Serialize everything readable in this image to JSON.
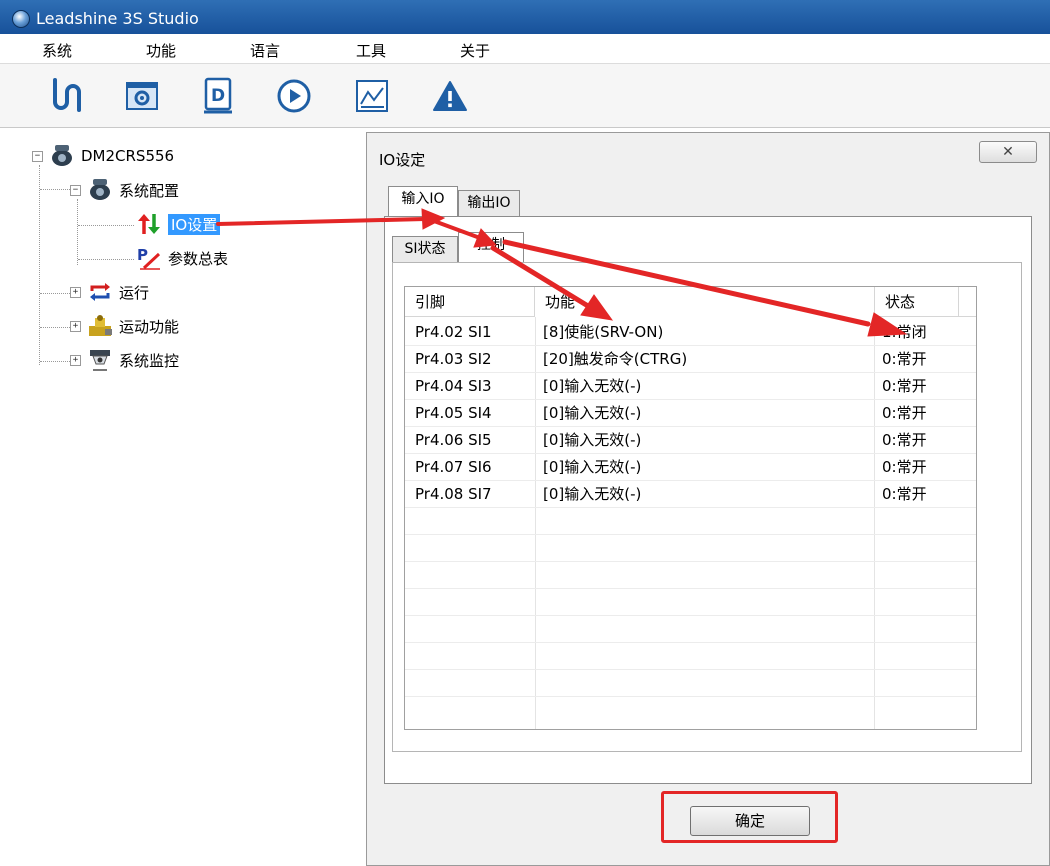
{
  "window": {
    "title": "Leadshine 3S Studio"
  },
  "menu": [
    "系统",
    "功能",
    "语言",
    "工具",
    "关于"
  ],
  "toolbar": {
    "icons": [
      "connect-icon",
      "settings-icon",
      "document-icon",
      "play-icon",
      "chart-icon",
      "warning-icon"
    ]
  },
  "tree": {
    "root": "DM2CRS556",
    "config": "系统配置",
    "io": "IO设置",
    "params": "参数总表",
    "run": "运行",
    "motion": "运动功能",
    "monitor": "系统监控",
    "expanded_symbol": "−",
    "collapsed_symbol": "+"
  },
  "dialog": {
    "title": "IO设定",
    "close_label": "✕",
    "tabs": [
      "输入IO",
      "输出IO"
    ],
    "subtabs": [
      "SI状态",
      "控制"
    ],
    "columns": [
      "引脚",
      "功能",
      "状态"
    ],
    "rows": [
      [
        "Pr4.02 SI1",
        "[8]使能(SRV-ON)",
        "1:常闭"
      ],
      [
        "Pr4.03 SI2",
        "[20]触发命令(CTRG)",
        "0:常开"
      ],
      [
        "Pr4.04 SI3",
        "[0]输入无效(-)",
        "0:常开"
      ],
      [
        "Pr4.05 SI4",
        "[0]输入无效(-)",
        "0:常开"
      ],
      [
        "Pr4.06 SI5",
        "[0]输入无效(-)",
        "0:常开"
      ],
      [
        "Pr4.07 SI6",
        "[0]输入无效(-)",
        "0:常开"
      ],
      [
        "Pr4.08 SI7",
        "[0]输入无效(-)",
        "0:常开"
      ]
    ],
    "ok_label": "确定"
  },
  "colors": {
    "arrow": "#e32626",
    "selection": "#3399ff",
    "titlebar": "#1d5aa3"
  }
}
